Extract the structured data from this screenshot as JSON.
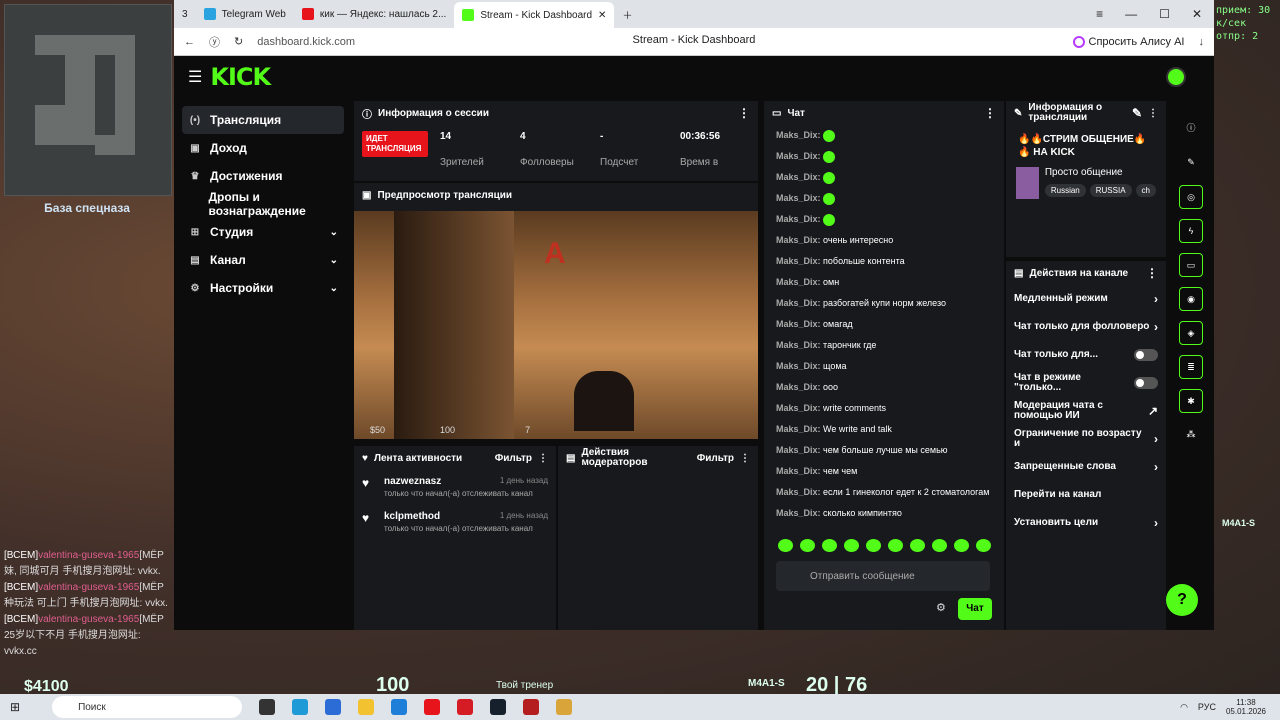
{
  "game": {
    "minimap_label": "База спецназа",
    "chat": [
      {
        "tag": "[ВСЕМ]",
        "name": "valentina-guseva-1965",
        "text": "[МЁР"
      },
      {
        "tag": "",
        "name": "",
        "text": "妹, 同城可月 手机搜月泡网址: vvkx."
      },
      {
        "tag": "[ВСЕМ]",
        "name": "valentina-guseva-1965",
        "text": "[МЁР"
      },
      {
        "tag": "",
        "name": "",
        "text": "种玩法 可上门 手机搜月泡网址: vvkx."
      },
      {
        "tag": "[ВСЕМ]",
        "name": "valentina-guseva-1965",
        "text": "[МЁР"
      },
      {
        "tag": "",
        "name": "",
        "text": "25岁以下不月 手机搜月泡网址: vvkx.cc"
      }
    ],
    "netstat": [
      "прием: 30 к/сек",
      "отпр: 2"
    ],
    "hud": {
      "money": "$4100",
      "health": "100",
      "trainer": "Твой тренер",
      "weapon": "M4A1-S",
      "ammo": "20",
      "reserve": "76",
      "right_weapon": "M4A1-S"
    }
  },
  "browser": {
    "tab_count": "3",
    "tabs": [
      {
        "label": "Telegram Web",
        "color": "#2aa3e0"
      },
      {
        "label": "кик — Яндекс: нашлась 2...",
        "color": "#e8141c"
      },
      {
        "label": "Stream - Kick Dashboard",
        "color": "#53fc18"
      }
    ],
    "url": "dashboard.kick.com",
    "page_title": "Stream - Kick Dashboard",
    "alice": "Спросить Алису AI"
  },
  "kick": {
    "logo": "KICK",
    "sidebar": [
      {
        "label": "Трансляция",
        "icon": "(•)",
        "chev": false,
        "active": true
      },
      {
        "label": "Доход",
        "icon": "▣",
        "chev": false,
        "active": false
      },
      {
        "label": "Достижения",
        "icon": "♛",
        "chev": false,
        "active": false
      },
      {
        "label": "Дропы и вознаграждение",
        "icon": "",
        "chev": false,
        "active": false
      },
      {
        "label": "Студия",
        "icon": "⊞",
        "chev": true,
        "active": false
      },
      {
        "label": "Канал",
        "icon": "▤",
        "chev": true,
        "active": false
      },
      {
        "label": "Настройки",
        "icon": "⚙",
        "chev": true,
        "active": false
      }
    ],
    "session": {
      "title": "Информация о сессии",
      "live": "ИДЕТ ТРАНСЛЯЦИЯ",
      "stats": [
        {
          "value": "14",
          "label": "Зрителей"
        },
        {
          "value": "4",
          "label": "Фолловеры"
        },
        {
          "value": "-",
          "label": "Подсчет"
        },
        {
          "value": "00:36:56",
          "label": "Время в"
        }
      ]
    },
    "preview": {
      "title": "Предпросмотр трансляции",
      "sign": "A",
      "hud_money": "$50",
      "hud_hp": "100",
      "hud_ammo": "7"
    },
    "activity": {
      "title": "Лента активности",
      "filter": "Фильтр",
      "items": [
        {
          "name": "nazweznasz",
          "time": "1 день назад",
          "text": "только что начал(-а) отслеживать канал"
        },
        {
          "name": "kclpmethod",
          "time": "1 день назад",
          "text": "только что начал(-а) отслеживать канал"
        }
      ]
    },
    "mods": {
      "title": "Действия модераторов",
      "filter": "Фильтр"
    },
    "chat": {
      "title": "Чат",
      "messages": [
        {
          "user": "Maks_Dix:",
          "text": "",
          "emote": true
        },
        {
          "user": "Maks_Dix:",
          "text": "",
          "emote": true
        },
        {
          "user": "Maks_Dix:",
          "text": "",
          "emote": true
        },
        {
          "user": "Maks_Dix:",
          "text": "",
          "emote": true
        },
        {
          "user": "Maks_Dix:",
          "text": "",
          "emote": true
        },
        {
          "user": "Maks_Dix:",
          "text": "очень интересно",
          "emote": false
        },
        {
          "user": "Maks_Dix:",
          "text": "побольше контента",
          "emote": false
        },
        {
          "user": "Maks_Dix:",
          "text": "омн",
          "emote": false
        },
        {
          "user": "Maks_Dix:",
          "text": "разбогатей купи норм железо",
          "emote": false
        },
        {
          "user": "Maks_Dix:",
          "text": "омагад",
          "emote": false
        },
        {
          "user": "Maks_Dix:",
          "text": "тарончик где",
          "emote": false
        },
        {
          "user": "Maks_Dix:",
          "text": "щома",
          "emote": false
        },
        {
          "user": "Maks_Dix:",
          "text": "ооо",
          "emote": false
        },
        {
          "user": "Maks_Dix:",
          "text": "write comments",
          "emote": false
        },
        {
          "user": "Maks_Dix:",
          "text": "We write and talk",
          "emote": false
        },
        {
          "user": "Maks_Dix:",
          "text": "чем больше лучше мы семью",
          "emote": false
        },
        {
          "user": "Maks_Dix:",
          "text": "чем чем",
          "emote": false
        },
        {
          "user": "Maks_Dix:",
          "text": "если 1 гинеколог едет к 2 стоматологам",
          "emote": false
        },
        {
          "user": "Maks_Dix:",
          "text": "сколько кимпинтяо",
          "emote": false
        }
      ],
      "placeholder": "Отправить сообщение",
      "send": "Чат"
    },
    "stream_info": {
      "title": "Информация о трансляции",
      "stream_title": "🔥🔥СТРИМ ОБЩЕНИЕ🔥🔥 НА KICK",
      "category": "Просто общение",
      "tags": [
        "Russian",
        "RUSSIA",
        "ch"
      ]
    },
    "actions": {
      "title": "Действия на канале",
      "items": [
        {
          "label": "Медленный режим",
          "kind": "arrow"
        },
        {
          "label": "Чат только для фолловеро",
          "kind": "arrow"
        },
        {
          "label": "Чат только для...",
          "kind": "toggle"
        },
        {
          "label": "Чат в режиме \"только...",
          "kind": "toggle"
        },
        {
          "label": "Модерация чата с помощью ИИ",
          "kind": "ext"
        },
        {
          "label": "Ограничение по возрасту и",
          "kind": "arrow"
        },
        {
          "label": "Запрещенные слова",
          "kind": "arrow"
        },
        {
          "label": "Перейти на канал",
          "kind": "none"
        },
        {
          "label": "Установить цели",
          "kind": "arrow"
        }
      ]
    }
  },
  "taskbar": {
    "search": "Поиск",
    "lang": "РУС",
    "time": "11:38",
    "date": "05.01.2026"
  }
}
